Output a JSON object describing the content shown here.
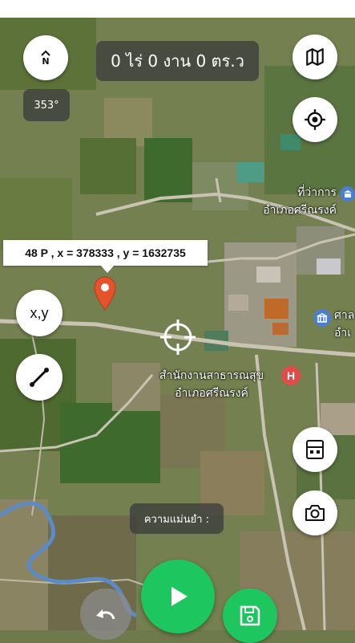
{
  "area_display": {
    "text": "0 ไร่ 0 งาน 0 ตร.ว"
  },
  "compass": {
    "north_letter": "N",
    "bearing": "353°"
  },
  "coordinate_label": {
    "text": "48 P , x = 378333 , y = 1632735"
  },
  "accuracy": {
    "text": "ความแม่นยำ :"
  },
  "map_labels": {
    "district_office_line1": "ที่ว่าการ",
    "district_office_line2": "อำเภอศรีณรงค์",
    "health_office_line1": "สำนักงานสาธารณสุข",
    "health_office_line2": "อำเภอศรีณรงค์",
    "partial_line1": "ศาล",
    "partial_line2": "อำเ"
  },
  "buttons": {
    "xy_label": "x,y"
  },
  "colors": {
    "marker": "#e5532b",
    "primary_green": "#1ec65f",
    "hospital_pin": "#e34b4b",
    "poi_blue": "#4a7fd0"
  },
  "icons": [
    "compass-icon",
    "map-icon",
    "locate-icon",
    "measure-line-icon",
    "calculator-icon",
    "camera-icon",
    "play-icon",
    "save-icon",
    "undo-icon",
    "crosshair-icon",
    "location-pin-icon"
  ]
}
